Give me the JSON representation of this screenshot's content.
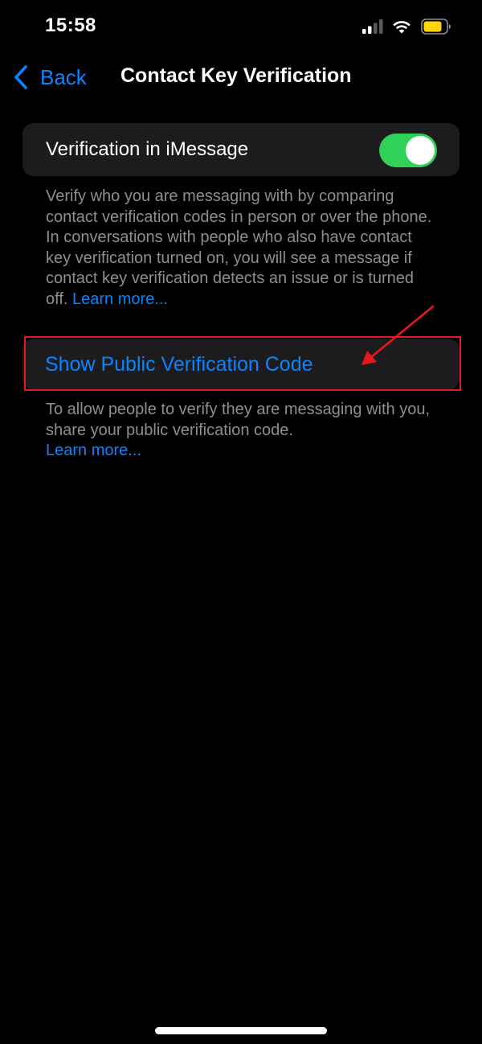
{
  "status_bar": {
    "time": "15:58",
    "icons": [
      "signal-icon",
      "wifi-icon",
      "battery-icon"
    ]
  },
  "nav": {
    "back_label": "Back",
    "title": "Contact Key Verification"
  },
  "verification_toggle": {
    "label": "Verification in iMessage",
    "enabled": true
  },
  "verification_footer": {
    "text": "Verify who you are messaging with by comparing contact verification codes in person or over the phone. In conversations with people who also have contact key verification turned on, you will see a message if contact key verification detects an issue or is turned off.",
    "link": "Learn more..."
  },
  "public_code": {
    "label": "Show Public Verification Code"
  },
  "public_code_footer": {
    "text": "To allow people to verify they are messaging with you, share your public verification code.",
    "link": "Learn more..."
  },
  "colors": {
    "accent": "#0a84ff",
    "toggle_on": "#30d158",
    "annotation": "#e5191c",
    "cell_background": "#1c1c1e",
    "secondary_text": "#8e8e93",
    "battery": "#ffd60a"
  }
}
